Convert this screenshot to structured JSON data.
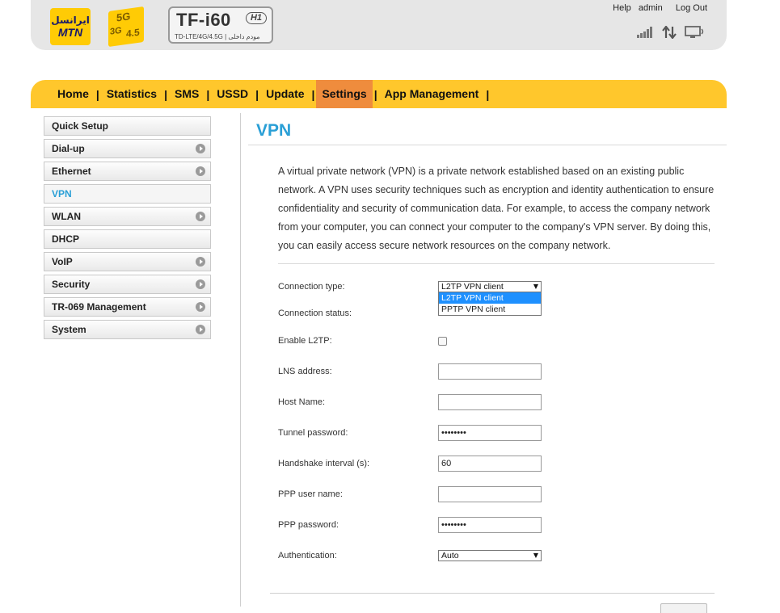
{
  "header": {
    "logo_fa": "ایرانسل",
    "logo_en": "MTN",
    "badge_5g": "5G",
    "badge_3g": "3G",
    "badge_45": "4.5",
    "model": "TF-i60",
    "model_badge": "H1",
    "model_sub": "TD-LTE/4G/4.5G | مودم داخلی",
    "links": {
      "help": "Help",
      "user": "admin",
      "logout": "Log Out"
    },
    "icons": [
      "signal-icon",
      "data-transfer-icon",
      "monitor-icon"
    ]
  },
  "nav": {
    "items": [
      "Home",
      "Statistics",
      "SMS",
      "USSD",
      "Update",
      "Settings",
      "App Management"
    ],
    "separator": "|",
    "active": "Settings"
  },
  "sidebar": {
    "items": [
      {
        "label": "Quick Setup",
        "arrow": false
      },
      {
        "label": "Dial-up",
        "arrow": true
      },
      {
        "label": "Ethernet",
        "arrow": true
      },
      {
        "label": "VPN",
        "arrow": false,
        "active": true
      },
      {
        "label": "WLAN",
        "arrow": true
      },
      {
        "label": "DHCP",
        "arrow": false
      },
      {
        "label": "VoIP",
        "arrow": true
      },
      {
        "label": "Security",
        "arrow": true
      },
      {
        "label": "TR-069 Management",
        "arrow": true
      },
      {
        "label": "System",
        "arrow": true
      }
    ]
  },
  "main": {
    "title": "VPN",
    "description": "A virtual private network (VPN) is a private network established based on an existing public network. A VPN uses security techniques such as encryption and identity authentication to ensure confidentiality and security of communication data. For example, to access the company network from your computer, you can connect your computer to the company's VPN server. By doing this, you can easily access secure network resources on the company network.",
    "form": {
      "connection_type_label": "Connection type:",
      "connection_type_value": "L2TP VPN client",
      "connection_type_options": [
        "L2TP VPN client",
        "PPTP VPN client"
      ],
      "connection_status_label": "Connection status:",
      "enable_l2tp_label": "Enable L2TP:",
      "lns_address_label": "LNS address:",
      "lns_address_value": "",
      "host_name_label": "Host Name:",
      "host_name_value": "",
      "tunnel_password_label": "Tunnel password:",
      "tunnel_password_value": "••••••••",
      "handshake_label": "Handshake interval (s):",
      "handshake_value": "60",
      "ppp_user_label": "PPP user name:",
      "ppp_user_value": "",
      "ppp_password_label": "PPP password:",
      "ppp_password_value": "••••••••",
      "authentication_label": "Authentication:",
      "authentication_value": "Auto"
    }
  },
  "colors": {
    "nav_bg": "#ffc72c",
    "nav_active": "#ef8c3d",
    "accent_blue": "#2a9fd6",
    "header_bg": "#e6e6e6"
  }
}
